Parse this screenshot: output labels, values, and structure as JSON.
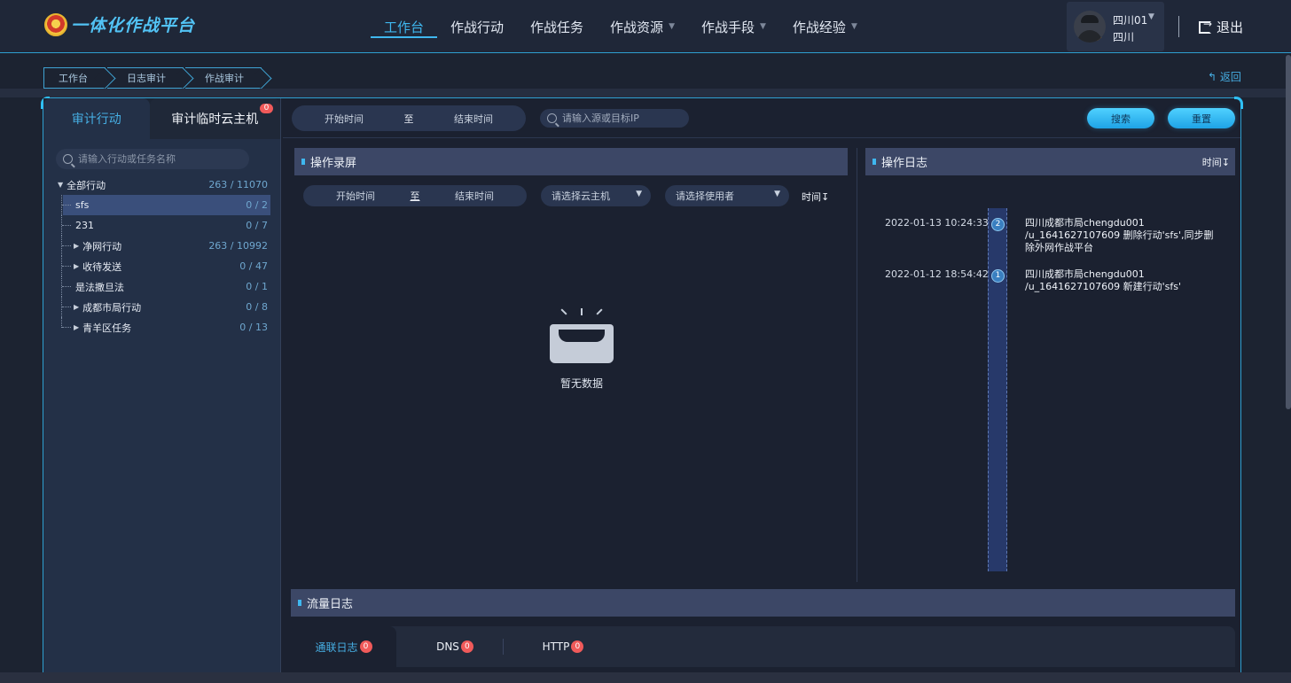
{
  "header": {
    "logo_text": "一体化作战平台",
    "nav": [
      {
        "label": "工作台",
        "active": true,
        "dropdown": false
      },
      {
        "label": "作战行动",
        "active": false,
        "dropdown": false
      },
      {
        "label": "作战任务",
        "active": false,
        "dropdown": false
      },
      {
        "label": "作战资源",
        "active": false,
        "dropdown": true
      },
      {
        "label": "作战手段",
        "active": false,
        "dropdown": true
      },
      {
        "label": "作战经验",
        "active": false,
        "dropdown": true
      }
    ],
    "user": {
      "name": "四川01",
      "region": "四川"
    },
    "logout_label": "退出"
  },
  "breadcrumb": [
    "工作台",
    "日志审计",
    "作战审计"
  ],
  "back_label": "返回",
  "left_panel": {
    "tabs": [
      {
        "label": "审计行动",
        "active": true
      },
      {
        "label": "审计临时云主机",
        "active": false,
        "badge": "0"
      }
    ],
    "search_placeholder": "请输入行动或任务名称",
    "tree": [
      {
        "label": "全部行动",
        "count": "263 / 11070",
        "level": 0,
        "expanded": true
      },
      {
        "label": "sfs",
        "count": "0 / 2",
        "level": 1,
        "selected": true
      },
      {
        "label": "231",
        "count": "0 / 7",
        "level": 1
      },
      {
        "label": "净网行动",
        "count": "263 / 10992",
        "level": 1,
        "expandable": true
      },
      {
        "label": "收待发送",
        "count": "0 / 47",
        "level": 1,
        "expandable": true
      },
      {
        "label": "是法撒旦法",
        "count": "0 / 1",
        "level": 1
      },
      {
        "label": "成都市局行动",
        "count": "0 / 8",
        "level": 1,
        "expandable": true
      },
      {
        "label": "青羊区任务",
        "count": "0 / 13",
        "level": 1,
        "expandable": true
      }
    ]
  },
  "filters": {
    "start_time": "开始时间",
    "to": "至",
    "end_time": "结束时间",
    "ip_placeholder": "请输入源或目标IP",
    "search_label": "搜索",
    "reset_label": "重置"
  },
  "recording": {
    "title": "操作录屏",
    "start_time": "开始时间",
    "to": "至",
    "end_time": "结束时间",
    "host_placeholder": "请选择云主机",
    "user_placeholder": "请选择使用者",
    "sort_label": "时间",
    "empty_text": "暂无数据"
  },
  "op_log": {
    "title": "操作日志",
    "sort_label": "时间",
    "entries": [
      {
        "index": "2",
        "time": "2022-01-13 10:24:33",
        "text": "四川成都市局chengdu001 /u_1641627107609 删除行动'sfs',同步删除外网作战平台"
      },
      {
        "index": "1",
        "time": "2022-01-12 18:54:42",
        "text": "四川成都市局chengdu001 /u_1641627107609 新建行动'sfs'"
      }
    ]
  },
  "flow_log": {
    "title": "流量日志",
    "tabs": [
      {
        "label": "通联日志",
        "badge": "0",
        "active": true
      },
      {
        "label": "DNS",
        "badge": "0",
        "active": false
      },
      {
        "label": "HTTP",
        "badge": "0",
        "active": false
      }
    ]
  },
  "colors": {
    "accent": "#3fb7ef",
    "badge": "#f05a5a",
    "background": "#1c2331"
  }
}
